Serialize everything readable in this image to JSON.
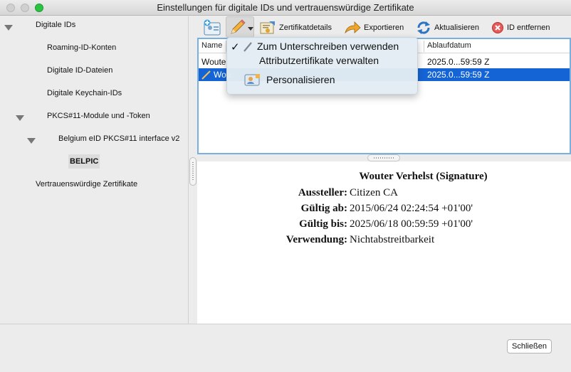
{
  "window": {
    "title": "Einstellungen für digitale IDs und vertrauenswürdige Zertifikate"
  },
  "sidebar": {
    "items": [
      {
        "label": "Digitale IDs"
      },
      {
        "label": "Roaming-ID-Konten"
      },
      {
        "label": "Digitale ID-Dateien"
      },
      {
        "label": "Digitale Keychain-IDs"
      },
      {
        "label": "PKCS#11-Module und -Token"
      },
      {
        "label": "Belgium eID PKCS#11 interface v2"
      },
      {
        "label": "BELPIC"
      },
      {
        "label": "Vertrauenswürdige Zertifikate"
      }
    ]
  },
  "toolbar": {
    "details_label": "Zertifikatdetails",
    "export_label": "Exportieren",
    "refresh_label": "Aktualisieren",
    "remove_label": "ID entfernen"
  },
  "table": {
    "headers": {
      "name": "Name",
      "expiry": "Ablaufdatum"
    },
    "rows": [
      {
        "name": "Woute",
        "expiry": "2025.0...59:59 Z"
      },
      {
        "name": "Wou",
        "expiry": "2025.0...59:59 Z"
      }
    ]
  },
  "menu": {
    "sign_label": "Zum Unterschreiben verwenden",
    "attr_label": "Attributzertifikate verwalten",
    "personalize_label": "Personalisieren"
  },
  "details": {
    "title": "Wouter Verhelst (Signature)",
    "issuer_label": "Aussteller:",
    "issuer_value": "Citizen CA",
    "valid_from_label": "Gültig ab:",
    "valid_from_value": "2015/06/24 02:24:54 +01'00'",
    "valid_to_label": "Gültig bis:",
    "valid_to_value": "2025/06/18 00:59:59 +01'00'",
    "usage_label": "Verwendung:",
    "usage_value": "Nichtabstreitbarkeit"
  },
  "footer": {
    "close_label": "Schließen"
  },
  "colors": {
    "accent": "#1564d6",
    "table_border": "#7ab0e0"
  }
}
